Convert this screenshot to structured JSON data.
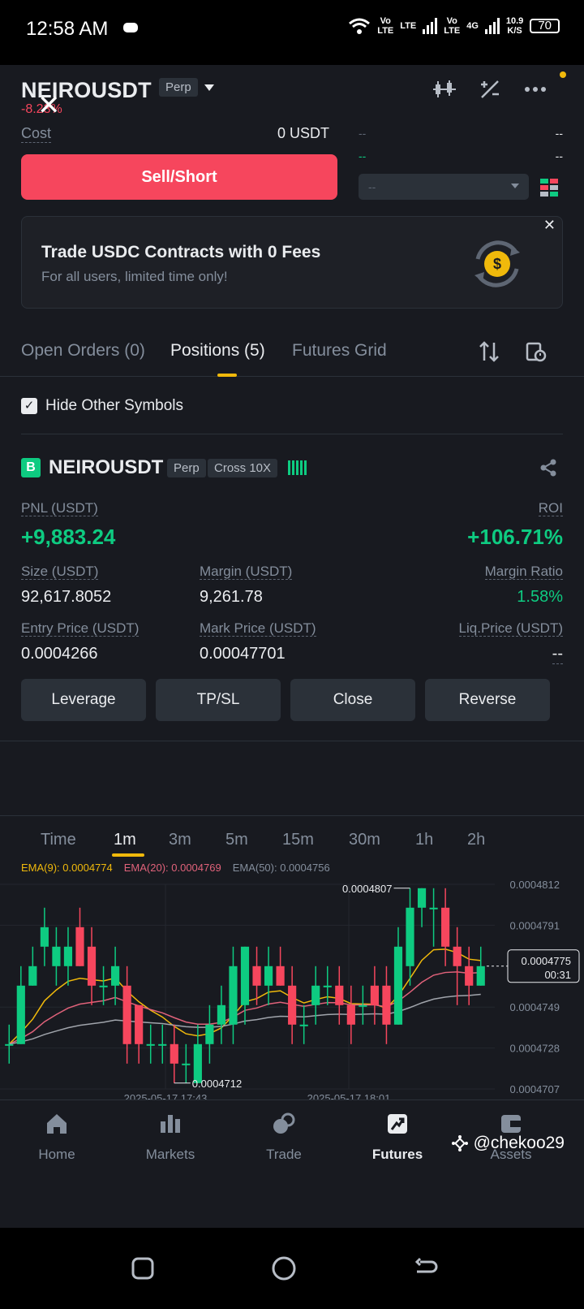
{
  "status_bar": {
    "time": "12:58 AM",
    "net1": "Vo",
    "net1b": "LTE",
    "net2": "LTE",
    "net3": "Vo",
    "net3b": "LTE",
    "net4": "4G",
    "speed": "10.9",
    "speed_unit": "K/S",
    "battery": "70"
  },
  "header": {
    "symbol": "NEIROUSDT",
    "type_tag": "Perp",
    "change": "-8.23%",
    "close_mark": "✕"
  },
  "order_form": {
    "cost_label": "Cost",
    "cost_value": "0 USDT",
    "sell_button": "Sell/Short",
    "orderbook_placeholder": "--",
    "orderbook_rows": [
      [
        "--",
        "--"
      ],
      [
        "--",
        "--"
      ]
    ]
  },
  "banner": {
    "title": "Trade USDC Contracts with 0 Fees",
    "subtitle": "For all users, limited time only!",
    "close": "✕"
  },
  "tabs": [
    {
      "label": "Open Orders (0)"
    },
    {
      "label": "Positions (5)"
    },
    {
      "label": "Futures Grid"
    }
  ],
  "filter": {
    "hide_label": "Hide Other Symbols",
    "checked": true
  },
  "position": {
    "badge": "B",
    "symbol": "NEIROUSDT",
    "type_tag": "Perp",
    "margin_mode": "Cross 10X",
    "pnl_label": "PNL (USDT)",
    "pnl_value": "+9,883.24",
    "roi_label": "ROI",
    "roi_value": "+106.71%",
    "size_label": "Size (USDT)",
    "size_value": "92,617.8052",
    "margin_label": "Margin (USDT)",
    "margin_value": "9,261.78",
    "margin_ratio_label": "Margin Ratio",
    "margin_ratio_value": "1.58%",
    "entry_label": "Entry Price (USDT)",
    "entry_value": "0.0004266",
    "mark_label": "Mark Price (USDT)",
    "mark_value": "0.00047701",
    "liq_label": "Liq.Price (USDT)",
    "liq_value": "--",
    "buttons": [
      "Leverage",
      "TP/SL",
      "Close",
      "Reverse"
    ]
  },
  "chart": {
    "timeframes": [
      "Time",
      "1m",
      "3m",
      "5m",
      "15m",
      "30m",
      "1h",
      "2h"
    ],
    "active_timeframe": "1m",
    "ema9": "EMA(9): 0.0004774",
    "ema20": "EMA(20): 0.0004769",
    "ema50": "EMA(50): 0.0004756",
    "price_ticks": [
      "0.0004812",
      "0.0004791",
      "0.0004749",
      "0.0004728",
      "0.0004707"
    ],
    "time_ticks": [
      "2025-05-17 17:43",
      "2025-05-17 18:01"
    ],
    "high_label": "0.0004807",
    "low_label": "0.0004712",
    "last_price": "0.0004775",
    "countdown": "00:31",
    "colors": {
      "up": "#0ecb81",
      "down": "#f6465d",
      "ema9": "#f0b90b",
      "ema20": "#e0627a",
      "ema50": "#a0a4ab"
    }
  },
  "chart_data": {
    "type": "candlestick",
    "x": [
      1,
      2,
      3,
      4,
      5,
      6,
      7,
      8,
      9,
      10,
      11,
      12,
      13,
      14,
      15,
      16,
      17,
      18,
      19,
      20,
      21,
      22,
      23,
      24,
      25,
      26,
      27,
      28,
      29,
      30,
      31,
      32,
      33,
      34,
      35,
      36,
      37,
      38,
      39,
      40,
      41
    ],
    "open": [
      0.000473,
      0.000473,
      0.000476,
      0.000478,
      0.000477,
      0.000477,
      0.000479,
      0.000478,
      0.000476,
      0.000476,
      0.000476,
      0.000475,
      0.000473,
      0.000473,
      0.000473,
      0.000472,
      0.000471,
      0.000473,
      0.000474,
      0.000474,
      0.000475,
      0.000477,
      0.000476,
      0.000477,
      0.000476,
      0.000474,
      0.000475,
      0.000476,
      0.000476,
      0.000475,
      0.000475,
      0.000476,
      0.000476,
      0.000474,
      0.000477,
      0.00048,
      0.00048,
      0.00048,
      0.000478,
      0.000477,
      0.000476
    ],
    "close": [
      0.000473,
      0.000476,
      0.000477,
      0.000479,
      0.000478,
      0.000478,
      0.000477,
      0.000476,
      0.000476,
      0.000477,
      0.000473,
      0.000473,
      0.000473,
      0.000473,
      0.000472,
      0.000472,
      0.000473,
      0.000474,
      0.000475,
      0.000477,
      0.000478,
      0.000476,
      0.000477,
      0.000476,
      0.000474,
      0.000474,
      0.000476,
      0.000476,
      0.000475,
      0.000474,
      0.000475,
      0.000475,
      0.000474,
      0.000478,
      0.00048,
      0.000481,
      0.00048,
      0.000478,
      0.000477,
      0.000476,
      0.000477
    ],
    "high": [
      0.000474,
      0.000477,
      0.000478,
      0.00048,
      0.000479,
      0.000479,
      0.00048,
      0.000479,
      0.000477,
      0.000478,
      0.000477,
      0.000475,
      0.000474,
      0.000474,
      0.000474,
      0.000473,
      0.000474,
      0.000475,
      0.000476,
      0.000478,
      0.000478,
      0.000478,
      0.000478,
      0.000478,
      0.000477,
      0.000475,
      0.000477,
      0.000477,
      0.000477,
      0.000476,
      0.000476,
      0.000477,
      0.000477,
      0.000479,
      0.000481,
      0.000481,
      0.000481,
      0.000481,
      0.000479,
      0.000478,
      0.000478
    ],
    "low": [
      0.000472,
      0.000473,
      0.000476,
      0.000477,
      0.000476,
      0.000476,
      0.000477,
      0.000475,
      0.000475,
      0.000475,
      0.000472,
      0.000472,
      0.000472,
      0.000472,
      0.000471,
      0.000471,
      0.000471,
      0.000472,
      0.000473,
      0.000473,
      0.000474,
      0.000475,
      0.000475,
      0.000476,
      0.000473,
      0.000473,
      0.000474,
      0.000475,
      0.000474,
      0.000473,
      0.000474,
      0.000474,
      0.000473,
      0.000474,
      0.000476,
      0.000479,
      0.000478,
      0.000477,
      0.000475,
      0.000475,
      0.000476
    ],
    "ylim": [
      0.0004707,
      0.0004812
    ]
  },
  "bottom_nav": [
    {
      "label": "Home",
      "icon": "home-icon"
    },
    {
      "label": "Markets",
      "icon": "markets-icon"
    },
    {
      "label": "Trade",
      "icon": "trade-icon"
    },
    {
      "label": "Futures",
      "icon": "futures-icon",
      "active": true
    },
    {
      "label": "Assets",
      "icon": "assets-icon"
    }
  ],
  "watermark": "@chekoo29"
}
